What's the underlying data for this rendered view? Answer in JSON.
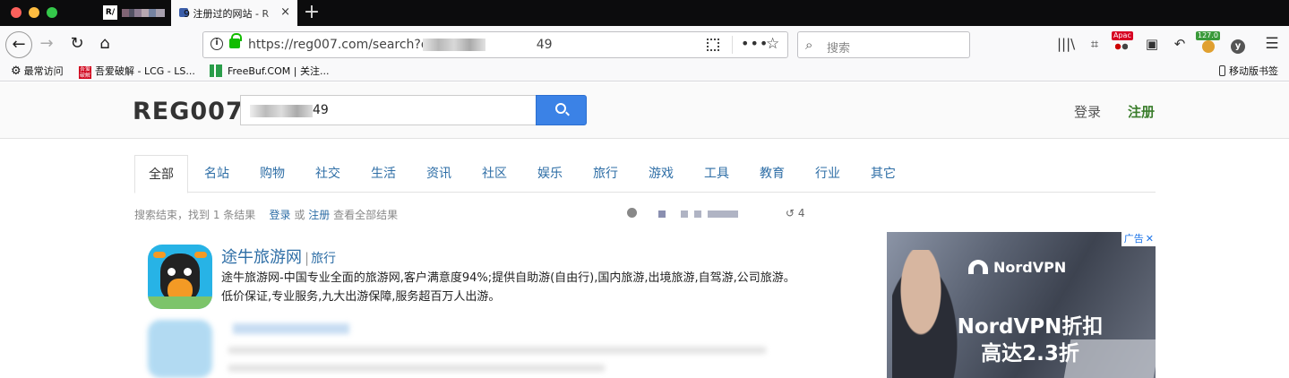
{
  "browser": {
    "tab_active_title": "9 注册过的网站 - R",
    "url_visible": "https://reg007.com/search?q",
    "url_suffix": "49",
    "search_placeholder": "搜索",
    "new_tab": "+",
    "badges": {
      "apac": "Apac",
      "version": "127.0"
    }
  },
  "bookmarks": [
    {
      "label": "最常访问"
    },
    {
      "label": "吾爱破解 - LCG - LS..."
    },
    {
      "label": "FreeBuf.COM | 关注..."
    }
  ],
  "bookmarks_right": "移动版书签",
  "site": {
    "logo": "REG007",
    "query_suffix": "49",
    "login": "登录",
    "register": "注册"
  },
  "categories": [
    "全部",
    "名站",
    "购物",
    "社交",
    "生活",
    "资讯",
    "社区",
    "娱乐",
    "旅行",
    "游戏",
    "工具",
    "教育",
    "行业",
    "其它"
  ],
  "stats": {
    "prefix": "搜索结束，找到 1 条结果",
    "login_link": "登录",
    "or": "或",
    "register_link": "注册",
    "suffix": "查看全部结果",
    "history_count": "4"
  },
  "result": {
    "title": "途牛旅游网",
    "category": "旅行",
    "description": "途牛旅游网-中国专业全面的旅游网,客户满意度94%;提供自助游(自由行),国内旅游,出境旅游,自驾游,公司旅游。低价保证,专业服务,九大出游保障,服务超百万人出游。"
  },
  "ad": {
    "badge": "广告",
    "brand": "NordVPN",
    "headline1": "NordVPN折扣",
    "headline2": "高达2.3折"
  },
  "colors": {
    "link_blue": "#2e6ea6",
    "search_btn": "#3b82e6",
    "register_green": "#3a7d2c"
  }
}
